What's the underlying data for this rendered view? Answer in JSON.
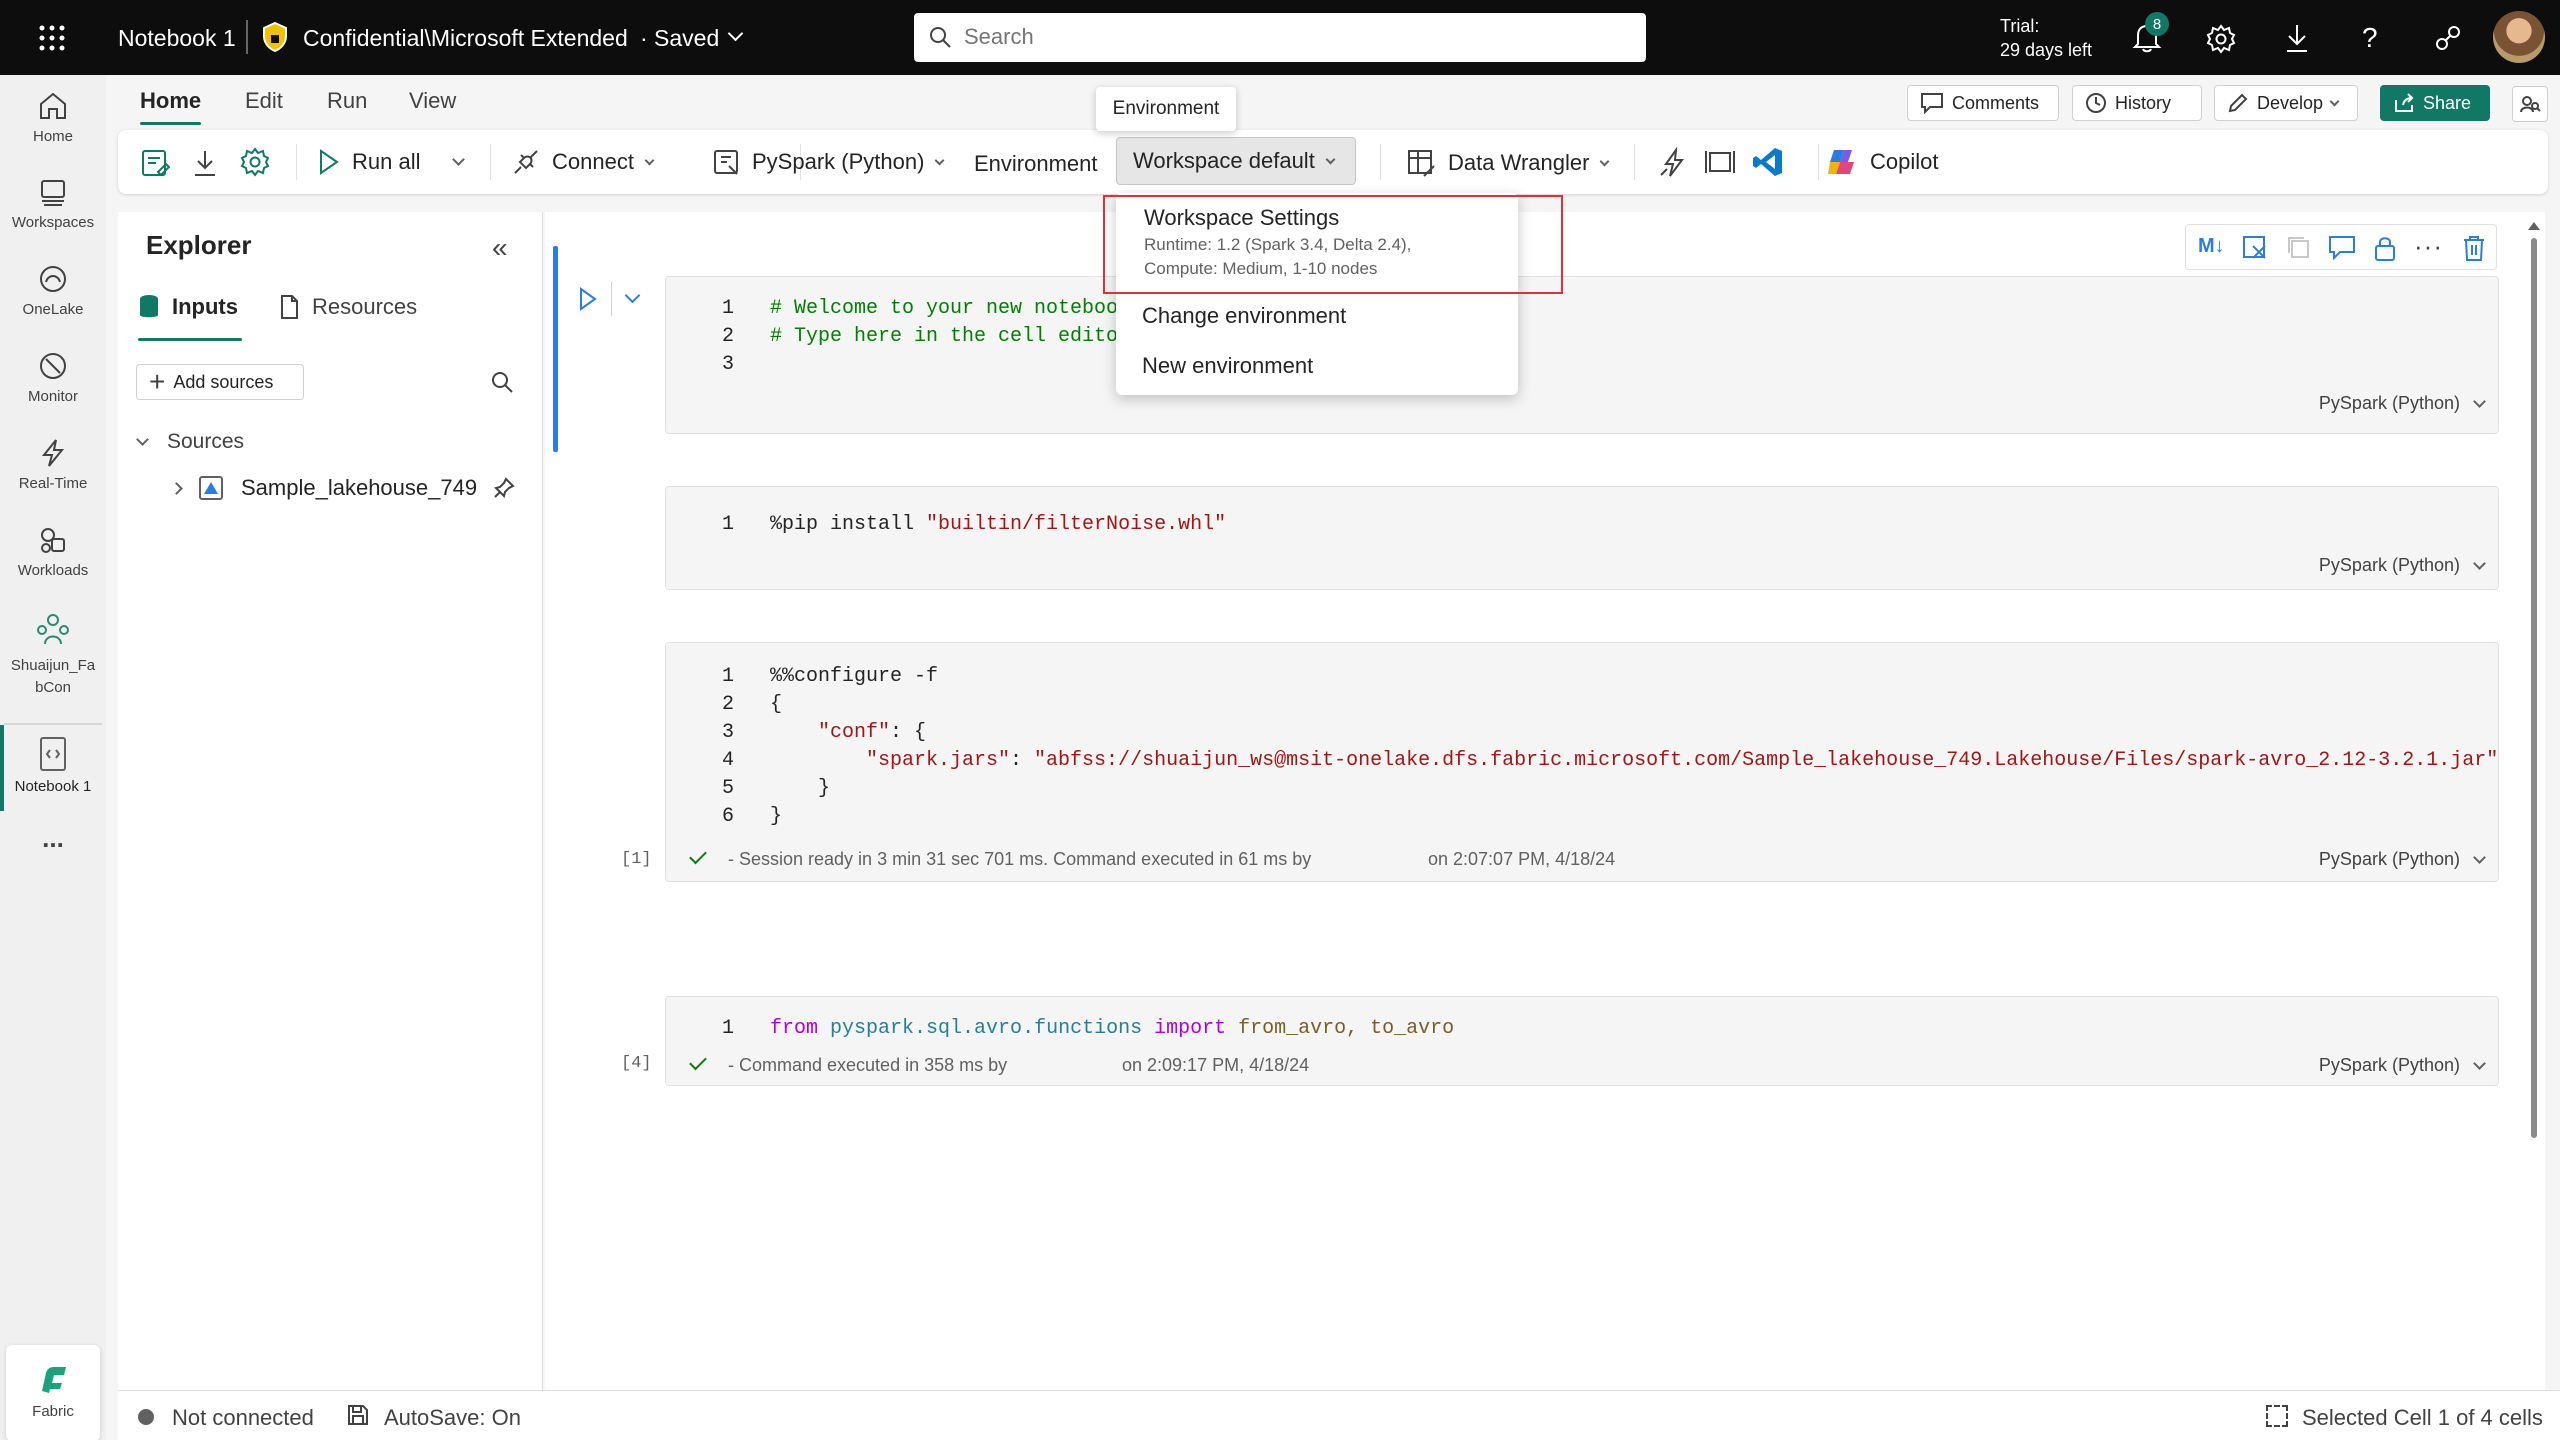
{
  "topbar": {
    "notebook_title": "Notebook 1",
    "sensitivity": "Confidential\\Microsoft Extended",
    "saved": "· Saved",
    "search_placeholder": "Search",
    "trial_line1": "Trial:",
    "trial_line2": "29 days left",
    "notification_count": "8"
  },
  "rail": {
    "items": [
      {
        "label": "Home"
      },
      {
        "label": "Workspaces"
      },
      {
        "label": "OneLake"
      },
      {
        "label": "Monitor"
      },
      {
        "label": "Real-Time"
      },
      {
        "label": "Workloads"
      },
      {
        "label": "Shuaijun_Fa"
      },
      {
        "label": "bCon"
      },
      {
        "label": "Notebook 1"
      },
      {
        "label": "..."
      }
    ],
    "fabric_label": "Fabric"
  },
  "menu_tabs": [
    "Home",
    "Edit",
    "Run",
    "View"
  ],
  "top_actions": {
    "comments": "Comments",
    "history": "History",
    "develop": "Develop",
    "share": "Share"
  },
  "ribbon": {
    "run_all": "Run all",
    "connect": "Connect",
    "language": "PySpark (Python)",
    "environment_label": "Environment",
    "environment_value": "Workspace default",
    "data_wrangler": "Data Wrangler",
    "copilot": "Copilot",
    "tooltip": "Environment"
  },
  "env_dropdown": {
    "title": "Workspace Settings",
    "line1": "Runtime: 1.2 (Spark 3.4, Delta 2.4),",
    "line2": "Compute: Medium, 1-10 nodes",
    "change": "Change environment",
    "new": "New environment"
  },
  "explorer": {
    "title": "Explorer",
    "tab_inputs": "Inputs",
    "tab_resources": "Resources",
    "add_sources": "Add sources",
    "sources": "Sources",
    "lakehouse": "Sample_lakehouse_749"
  },
  "cells": {
    "c1": {
      "l1": "# Welcome to your new notebook",
      "l2": "# Type here in the cell editor",
      "lang": "PySpark (Python)"
    },
    "c2": {
      "l1a": "%pip install ",
      "l1b": "\"builtin/filterNoise.whl\"",
      "lang": "PySpark (Python)"
    },
    "c3": {
      "l1": "%%configure -f",
      "l2": "{",
      "l3a": "\"conf\"",
      "l3b": ": {",
      "l4a": "\"spark.jars\"",
      "l4b": ": ",
      "l4c": "\"abfss://shuaijun_ws@msit-onelake.dfs.fabric.microsoft.com/Sample_lakehouse_749.Lakehouse/Files/spark-avro_2.12-3.2.1.jar\"",
      "l5": "}",
      "l6": "}",
      "exec": "[1]",
      "status_a": "- Session ready in 3 min 31 sec 701 ms. Command executed in 61 ms by",
      "status_b": "on 2:07:07 PM, 4/18/24",
      "lang": "PySpark (Python)"
    },
    "c4": {
      "kw_from": "from",
      "module": "pyspark.sql.avro.functions",
      "kw_import": "import",
      "names": "from_avro, to_avro",
      "exec": "[4]",
      "status_a": "- Command executed in 358 ms by",
      "status_b": "on 2:09:17 PM, 4/18/24",
      "lang": "PySpark (Python)"
    }
  },
  "statusbar": {
    "connection": "Not connected",
    "autosave": "AutoSave: On",
    "selection": "Selected Cell 1 of 4 cells"
  },
  "colors": {
    "accent": "#117865",
    "highlight_box": "#e0303a",
    "topbar": "#0d0d0d"
  }
}
